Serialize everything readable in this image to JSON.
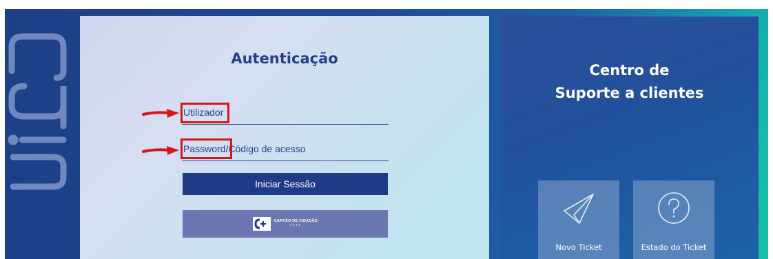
{
  "brand": {
    "logo_text": "siga"
  },
  "login": {
    "title": "Autenticação",
    "username_placeholder": "Utilizador",
    "password_placeholder": "Password/Código de acesso",
    "submit_label": "Iniciar Sessão",
    "citizen_card_label": "CARTÃO DE CIDADÃO",
    "citizen_card_dots": "••••"
  },
  "support": {
    "title_line1": "Centro de",
    "title_line2": "Suporte a clientes",
    "tiles": [
      {
        "label": "Novo Ticket",
        "icon": "paper-plane-icon"
      },
      {
        "label": "Estado do Ticket",
        "icon": "question-circle-icon"
      }
    ]
  },
  "annotations": {
    "highlight_color": "#d91414"
  },
  "colors": {
    "primary": "#1f3b85",
    "title": "#25408a",
    "citizen_card": "#6c76b2"
  }
}
